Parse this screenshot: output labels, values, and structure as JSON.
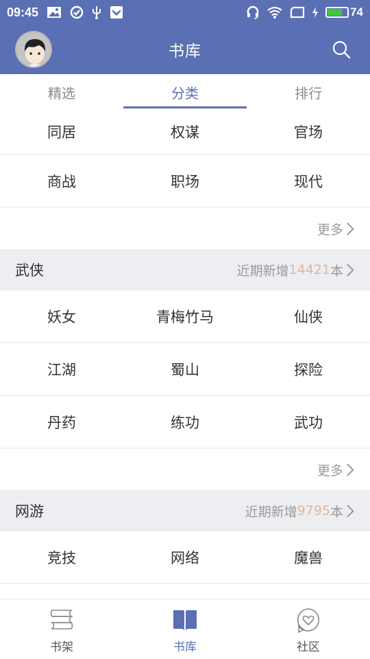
{
  "status_bar": {
    "time": "09:45",
    "battery_level": "74",
    "battery_percent": 74,
    "left_icons": [
      "image-notification-icon",
      "check-circle-icon",
      "usb-icon",
      "shield-icon"
    ],
    "right_icons": [
      "headset-icon",
      "wifi-icon",
      "screen-icon",
      "charging-icon",
      "battery-icon"
    ]
  },
  "header": {
    "title": "书库",
    "avatar_icon": "user-avatar",
    "search_icon": "search-icon"
  },
  "tabs": [
    {
      "label": "精选",
      "active": false
    },
    {
      "label": "分类",
      "active": true
    },
    {
      "label": "排行",
      "active": false
    }
  ],
  "top_section": {
    "rows": [
      [
        "同居",
        "权谋",
        "官场"
      ],
      [
        "商战",
        "职场",
        "现代"
      ]
    ],
    "more_label": "更多"
  },
  "sections": [
    {
      "title": "武侠",
      "stat_prefix": "近期新增",
      "stat_count": "14421",
      "stat_suffix": "本",
      "rows": [
        [
          "妖女",
          "青梅竹马",
          "仙侠"
        ],
        [
          "江湖",
          "蜀山",
          "探险"
        ],
        [
          "丹药",
          "练功",
          "武功"
        ]
      ],
      "more_label": "更多"
    },
    {
      "title": "网游",
      "stat_prefix": "近期新增",
      "stat_count": "9795",
      "stat_suffix": "本",
      "rows": [
        [
          "竞技",
          "网络",
          "魔兽"
        ]
      ]
    }
  ],
  "bottom_nav": [
    {
      "label": "书架",
      "icon": "bookshelf-icon",
      "active": false
    },
    {
      "label": "书库",
      "icon": "open-book-icon",
      "active": true
    },
    {
      "label": "社区",
      "icon": "community-heart-icon",
      "active": false
    }
  ],
  "colors": {
    "primary": "#5a6fb4",
    "section_bg": "#eceef1",
    "stat_number": "#e3b69a",
    "battery": "#3ec53a"
  }
}
